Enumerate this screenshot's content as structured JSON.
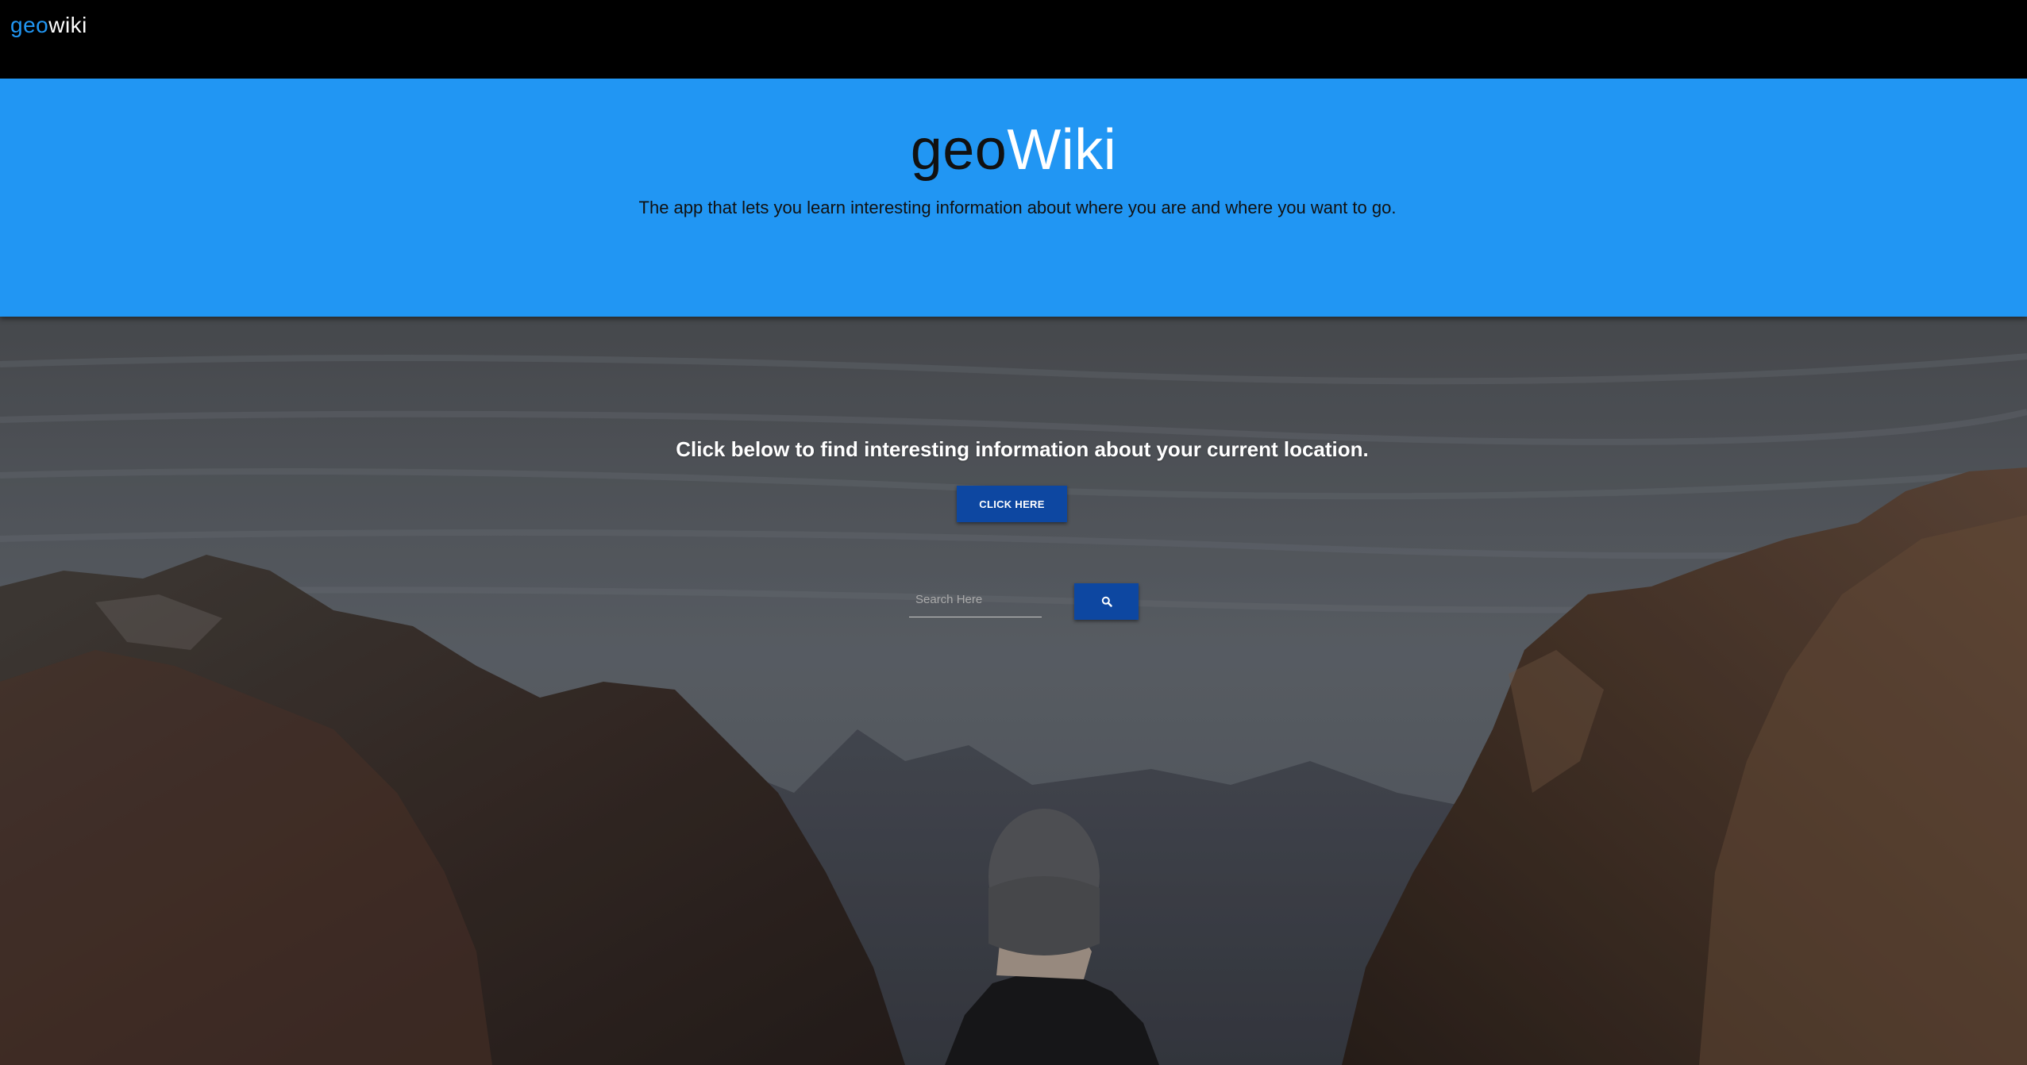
{
  "navbar": {
    "brand_geo": "geo",
    "brand_wiki": "wiki"
  },
  "hero": {
    "title_geo": "geo",
    "title_wiki": "Wiki",
    "tagline": "The app that lets you learn interesting information about where you are and where you want to go."
  },
  "main": {
    "cta_text": "Click below to find interesting information about your current location.",
    "click_button_label": "CLICK HERE",
    "search_placeholder": "Search Here",
    "search_value": "",
    "search_button_icon": "search-icon"
  },
  "colors": {
    "accent": "#2196F3",
    "button": "#0D47A1",
    "navbar": "#000000"
  }
}
